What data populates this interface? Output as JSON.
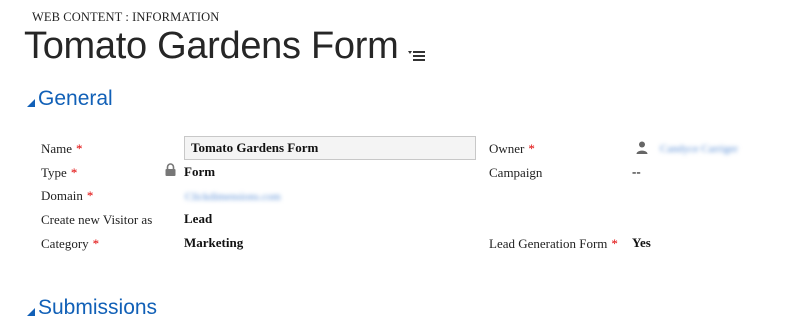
{
  "header": {
    "entity_type": "WEB CONTENT : INFORMATION",
    "title": "Tomato Gardens Form",
    "form_selector_icon": "list-menu-icon"
  },
  "sections": {
    "general": {
      "label": "General"
    },
    "submissions": {
      "label": "Submissions"
    }
  },
  "fields": {
    "name": {
      "label": "Name",
      "required": "*",
      "value": "Tomato Gardens Form"
    },
    "type": {
      "label": "Type",
      "required": "*",
      "value": "Form",
      "icon": "lock-icon"
    },
    "domain": {
      "label": "Domain",
      "required": "*",
      "value": "Clickdimensions.com"
    },
    "create_visitor": {
      "label": "Create new Visitor as",
      "value": "Lead"
    },
    "category": {
      "label": "Category",
      "required": "*",
      "value": "Marketing"
    },
    "owner": {
      "label": "Owner",
      "required": "*",
      "value": "Candyce Carriger",
      "icon": "user-icon"
    },
    "campaign": {
      "label": "Campaign",
      "value": "--"
    },
    "lead_generation_form": {
      "label": "Lead Generation Form",
      "required": "*",
      "value": "Yes"
    }
  },
  "colors": {
    "accent": "#1160b7",
    "required": "#e00000",
    "lookup_link": "#5b8fd6"
  }
}
